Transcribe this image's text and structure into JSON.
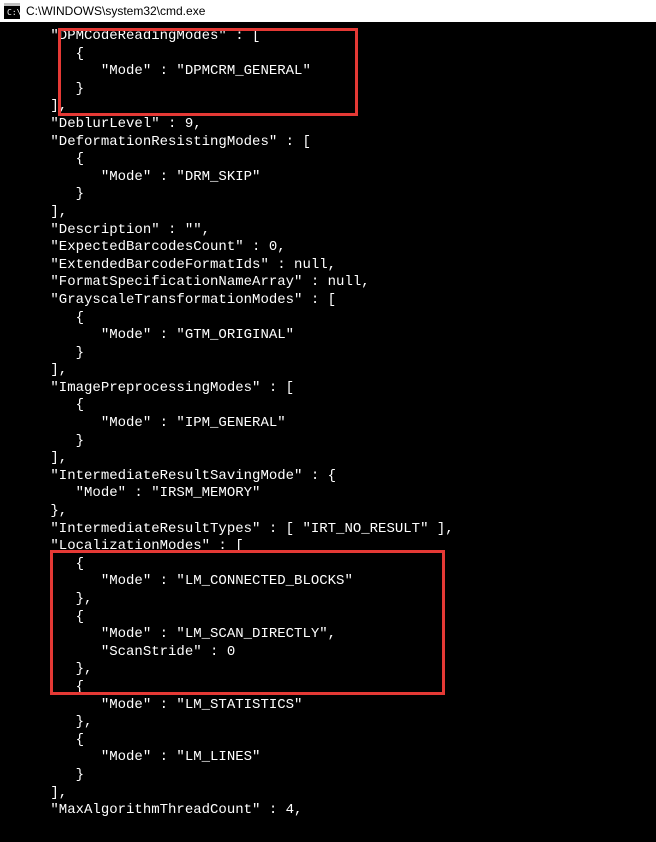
{
  "titlebar": {
    "path": "C:\\WINDOWS\\system32\\cmd.exe"
  },
  "lines": [
    "      \"DPMCodeReadingModes\" : [",
    "         {",
    "            \"Mode\" : \"DPMCRM_GENERAL\"",
    "         }",
    "      ],",
    "      \"DeblurLevel\" : 9,",
    "      \"DeformationResistingModes\" : [",
    "         {",
    "            \"Mode\" : \"DRM_SKIP\"",
    "         }",
    "      ],",
    "      \"Description\" : \"\",",
    "      \"ExpectedBarcodesCount\" : 0,",
    "      \"ExtendedBarcodeFormatIds\" : null,",
    "      \"FormatSpecificationNameArray\" : null,",
    "      \"GrayscaleTransformationModes\" : [",
    "         {",
    "            \"Mode\" : \"GTM_ORIGINAL\"",
    "         }",
    "      ],",
    "      \"ImagePreprocessingModes\" : [",
    "         {",
    "            \"Mode\" : \"IPM_GENERAL\"",
    "         }",
    "      ],",
    "      \"IntermediateResultSavingMode\" : {",
    "         \"Mode\" : \"IRSM_MEMORY\"",
    "      },",
    "      \"IntermediateResultTypes\" : [ \"IRT_NO_RESULT\" ],",
    "      \"LocalizationModes\" : [",
    "         {",
    "            \"Mode\" : \"LM_CONNECTED_BLOCKS\"",
    "         },",
    "         {",
    "            \"Mode\" : \"LM_SCAN_DIRECTLY\",",
    "            \"ScanStride\" : 0",
    "         },",
    "         {",
    "            \"Mode\" : \"LM_STATISTICS\"",
    "         },",
    "         {",
    "            \"Mode\" : \"LM_LINES\"",
    "         }",
    "      ],",
    "      \"MaxAlgorithmThreadCount\" : 4,"
  ]
}
